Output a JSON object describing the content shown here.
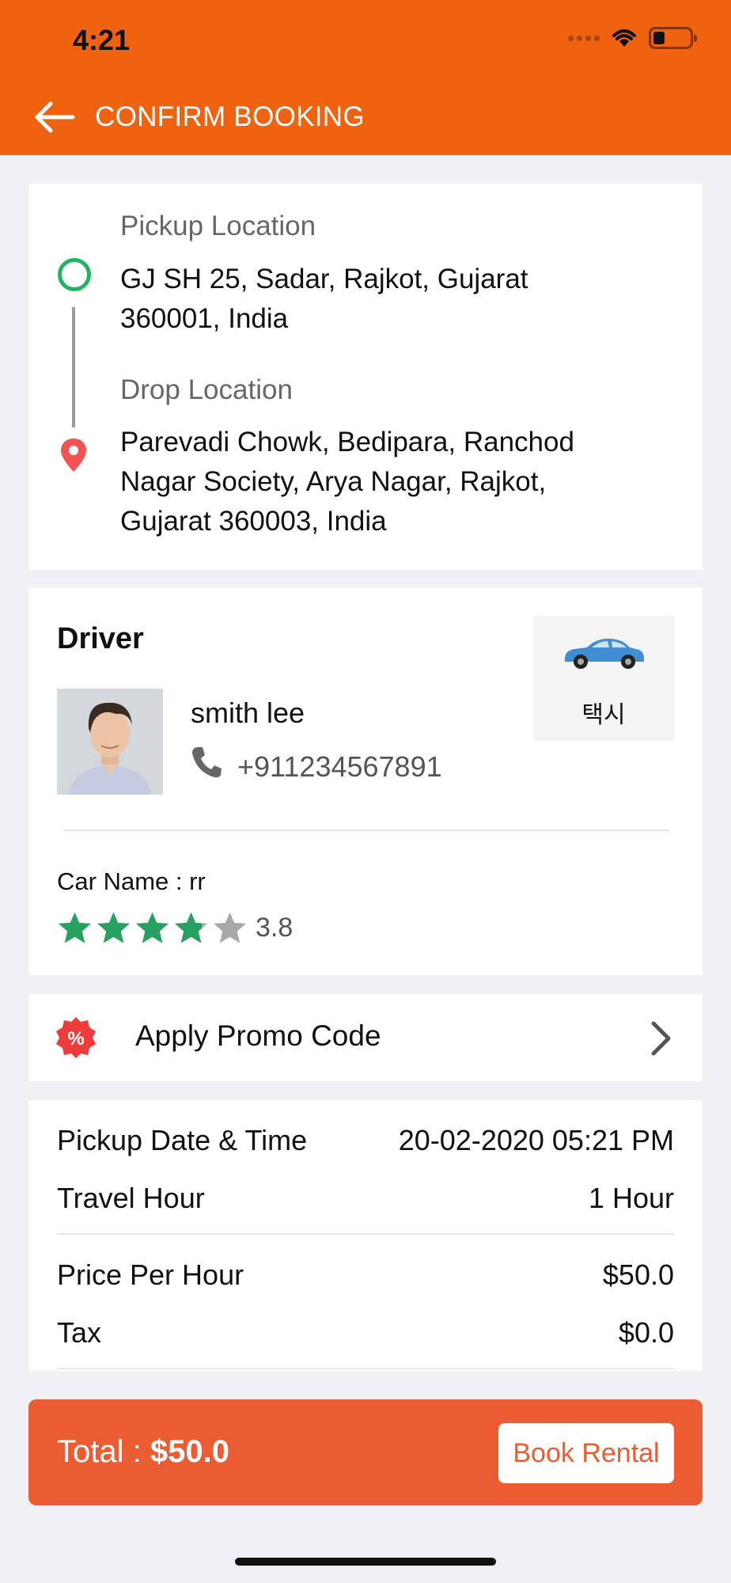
{
  "status_bar": {
    "time": "4:21"
  },
  "header": {
    "title": "CONFIRM BOOKING",
    "back_icon": "arrow-left-icon"
  },
  "locations": {
    "pickup_label": "Pickup Location",
    "pickup_value": "GJ SH 25, Sadar, Rajkot, Gujarat 360001, India",
    "drop_label": "Drop Location",
    "drop_value": "Parevadi Chowk, Bedipara, Ranchod Nagar Society, Arya Nagar, Rajkot, Gujarat 360003, India",
    "pickup_color": "#21b364",
    "drop_color": "#f25454"
  },
  "driver": {
    "title": "Driver",
    "name": "smith lee",
    "phone": "+911234567891",
    "vehicle_type": "택시",
    "car_name": "Car Name : rr",
    "rating": 3.8,
    "rating_label": "3.8",
    "rating_max": 5,
    "star_color": "#27a062"
  },
  "promo": {
    "label": "Apply Promo Code",
    "icon": "percent-badge-icon"
  },
  "fare": {
    "rows": [
      {
        "label": "Pickup Date & Time",
        "value": "20-02-2020 05:21 PM"
      },
      {
        "label": "Travel Hour",
        "value": "1 Hour"
      },
      {
        "label": "Price Per Hour",
        "value": "$50.0"
      },
      {
        "label": "Tax",
        "value": "$0.0"
      }
    ]
  },
  "footer": {
    "total_label": "Total : ",
    "total_amount": "$50.0",
    "book_button": "Book Rental",
    "accent": "#ec5c33"
  },
  "colors": {
    "header": "#ee6210",
    "background": "#efeff4"
  }
}
